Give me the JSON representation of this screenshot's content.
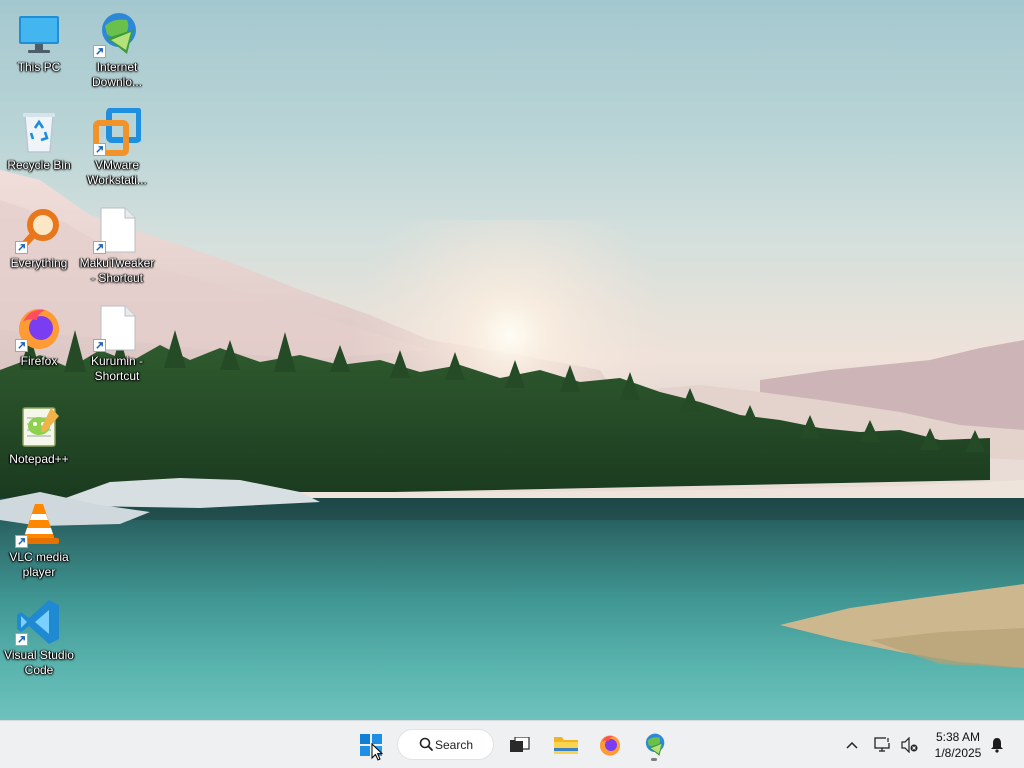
{
  "desktop": {
    "icons": [
      {
        "label": "This PC"
      },
      {
        "label": "Internet Downlo..."
      },
      {
        "label": "Recycle Bin"
      },
      {
        "label": "VMware Workstati..."
      },
      {
        "label": "Everything"
      },
      {
        "label": "MakuTweaker - Shortcut"
      },
      {
        "label": "Firefox"
      },
      {
        "label": "Kurumin - Shortcut"
      },
      {
        "label": "Notepad++"
      },
      {
        "label": "VLC media player"
      },
      {
        "label": "Visual Studio Code"
      }
    ]
  },
  "taskbar": {
    "search_label": "Search",
    "start_icon": "windows-logo-icon",
    "pinned": [
      "task-view-icon",
      "file-explorer-icon",
      "firefox-icon",
      "internet-download-manager-icon"
    ],
    "tray": [
      "chevron-up-icon",
      "network-icon",
      "volume-muted-icon",
      "notification-bell-icon"
    ],
    "clock": {
      "time": "5:38 AM",
      "date": "1/8/2025"
    }
  },
  "colors": {
    "taskbar_bg": "#eef0f2",
    "accent": "#0067c0"
  }
}
